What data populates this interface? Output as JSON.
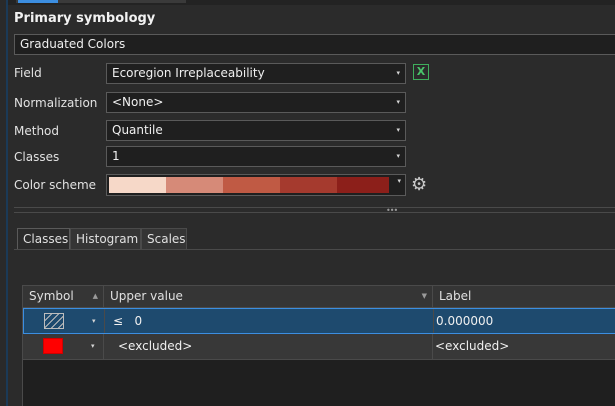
{
  "heading": "Primary symbology",
  "renderer": "Graduated Colors",
  "fields": {
    "field_label": "Field",
    "field_value": "Ecoregion Irreplaceability",
    "normalization_label": "Normalization",
    "normalization_value": "<None>",
    "method_label": "Method",
    "method_value": "Quantile",
    "classes_label": "Classes",
    "classes_value": "1",
    "color_scheme_label": "Color scheme"
  },
  "color_ramp": [
    "#f6d8c8",
    "#d68a78",
    "#c05a44",
    "#a53a2e",
    "#8c1f1a"
  ],
  "icons": {
    "chevron": "▾",
    "excel": "X",
    "gear": "⚙",
    "sort_up": "▲",
    "sort_down": "▼",
    "grip": "•••"
  },
  "tabs": [
    {
      "label": "Classes",
      "active": true
    },
    {
      "label": "Histogram",
      "active": false
    },
    {
      "label": "Scales",
      "active": false
    }
  ],
  "table": {
    "headers": [
      "Symbol",
      "Upper value",
      "Label"
    ],
    "rows": [
      {
        "symbol": "hatch",
        "upper_value": "≤   0",
        "label": "0.000000",
        "selected": true
      },
      {
        "symbol": "red",
        "upper_value": "<excluded>",
        "label": "<excluded>",
        "selected": false
      }
    ]
  }
}
